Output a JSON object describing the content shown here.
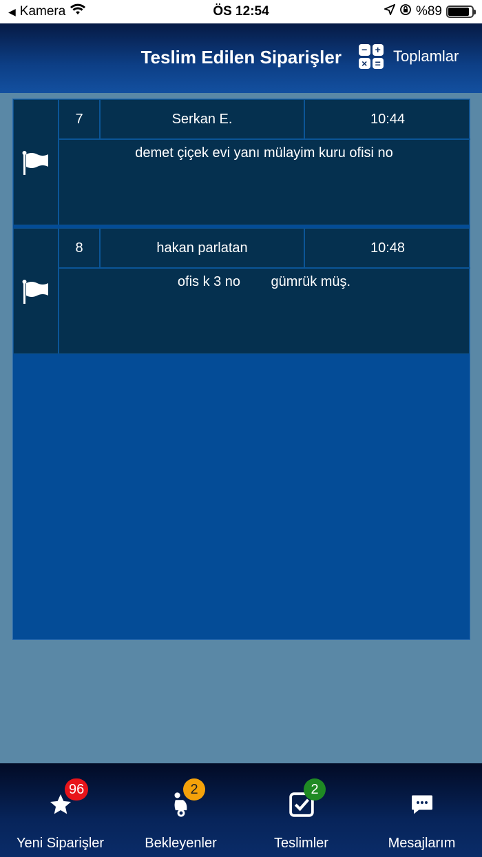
{
  "status_bar": {
    "back_app": "Kamera",
    "time": "ÖS 12:54",
    "battery": "%89",
    "battery_level": 0.89
  },
  "header": {
    "title": "Teslim Edilen Siparişler",
    "totals_label": "Toplamlar",
    "totals_icon": "calculator-icon"
  },
  "orders": [
    {
      "no": "7",
      "name": "Serkan E.",
      "time": "10:44",
      "address": "demet çiçek evi yanı mülayim kuru ofisi no",
      "icon": "flag-icon"
    },
    {
      "no": "8",
      "name": "hakan parlatan",
      "time": "10:48",
      "address": "ofis k 3 no        gümrük müş.",
      "icon": "flag-icon"
    }
  ],
  "tabbar": {
    "tabs": [
      {
        "label": "Yeni Siparişler",
        "badge": "96",
        "icon": "star-icon"
      },
      {
        "label": "Bekleyenler",
        "badge": "2",
        "icon": "scooter-icon"
      },
      {
        "label": "Teslimler",
        "badge": "2",
        "icon": "checkbox-icon"
      },
      {
        "label": "Mesajlarım",
        "badge": "",
        "icon": "message-icon"
      }
    ]
  },
  "colors": {
    "header_bg": "#0d3f86",
    "content_bg": "#044c97",
    "row_bg": "#05304f",
    "badge_red": "#e8141a",
    "badge_orange": "#f5a20a",
    "badge_green": "#1f8a23"
  }
}
